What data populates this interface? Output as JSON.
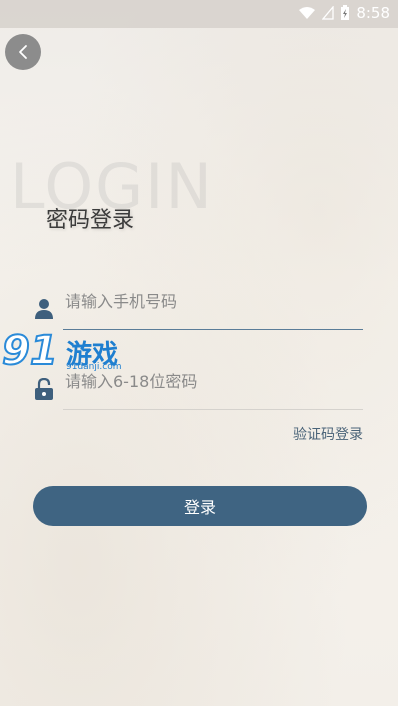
{
  "status_bar": {
    "time": "8:58"
  },
  "header": {
    "watermark_text": "LOGIN",
    "title": "密码登录"
  },
  "form": {
    "phone_placeholder": "请输入手机号码",
    "password_placeholder": "请输入6-18位密码",
    "sms_login_link": "验证码登录",
    "login_button": "登录"
  },
  "watermark_logo": {
    "number": "91",
    "name": "游戏",
    "url": "91danji.com"
  },
  "colors": {
    "accent": "#3f6482",
    "link": "#4a6378",
    "background": "#f4f1ec"
  },
  "icons": [
    "wifi-icon",
    "signal-icon",
    "battery-charging-icon",
    "back-arrow-icon",
    "user-icon",
    "lock-icon"
  ]
}
